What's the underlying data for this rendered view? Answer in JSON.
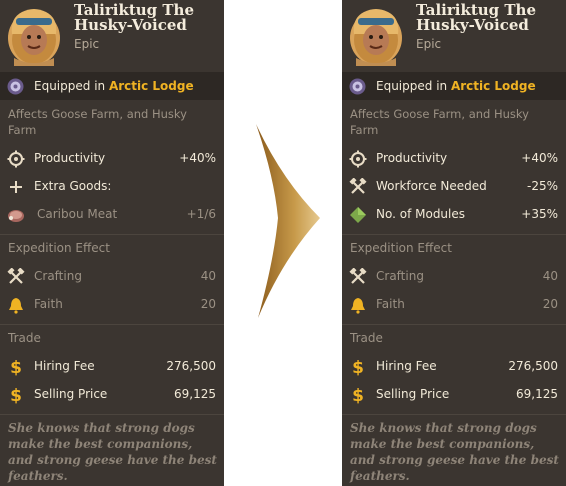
{
  "cards": [
    {
      "name": "Taliriktug The Husky-Voiced",
      "rarity": "Epic",
      "equipped_prefix": "Equipped in ",
      "equipped_location": "Arctic Lodge",
      "affects": "Affects Goose Farm, and Husky Farm",
      "effects": [
        {
          "icon": "productivity-gear-icon",
          "label": "Productivity",
          "value": "+40%"
        },
        {
          "icon": "plus-icon",
          "label": "Extra Goods:",
          "value": ""
        },
        {
          "icon": "caribou-meat-icon",
          "label": "Caribou Meat",
          "value": "+1/6"
        }
      ],
      "expedition_title": "Expedition Effect",
      "expedition": [
        {
          "icon": "crafting-tools-icon",
          "label": "Crafting",
          "value": "40"
        },
        {
          "icon": "faith-bell-icon",
          "label": "Faith",
          "value": "20"
        }
      ],
      "trade_title": "Trade",
      "trade": [
        {
          "icon": "dollar-icon",
          "label": "Hiring Fee",
          "value": "276,500"
        },
        {
          "icon": "dollar-icon",
          "label": "Selling Price",
          "value": "69,125"
        }
      ],
      "flavor": "She knows that strong dogs make the best companions, and strong geese have the best feathers."
    },
    {
      "name": "Taliriktug The Husky-Voiced",
      "rarity": "Epic",
      "equipped_prefix": "Equipped in ",
      "equipped_location": "Arctic Lodge",
      "affects": "Affects Goose Farm, and Husky Farm",
      "effects": [
        {
          "icon": "productivity-gear-icon",
          "label": "Productivity",
          "value": "+40%"
        },
        {
          "icon": "workforce-tools-icon",
          "label": "Workforce Needed",
          "value": "-25%"
        },
        {
          "icon": "modules-icon",
          "label": "No. of Modules",
          "value": "+35%"
        }
      ],
      "expedition_title": "Expedition Effect",
      "expedition": [
        {
          "icon": "crafting-tools-icon",
          "label": "Crafting",
          "value": "40"
        },
        {
          "icon": "faith-bell-icon",
          "label": "Faith",
          "value": "20"
        }
      ],
      "trade_title": "Trade",
      "trade": [
        {
          "icon": "dollar-icon",
          "label": "Hiring Fee",
          "value": "276,500"
        },
        {
          "icon": "dollar-icon",
          "label": "Selling Price",
          "value": "69,125"
        }
      ],
      "flavor": "She knows that strong dogs make the best companions, and strong geese have the best feathers."
    }
  ],
  "colors": {
    "panel": "#3b3530",
    "equip_bar": "#2d2824",
    "highlight": "#f0b323",
    "dim_text": "#9b9184",
    "arrow": "#b5832f"
  }
}
